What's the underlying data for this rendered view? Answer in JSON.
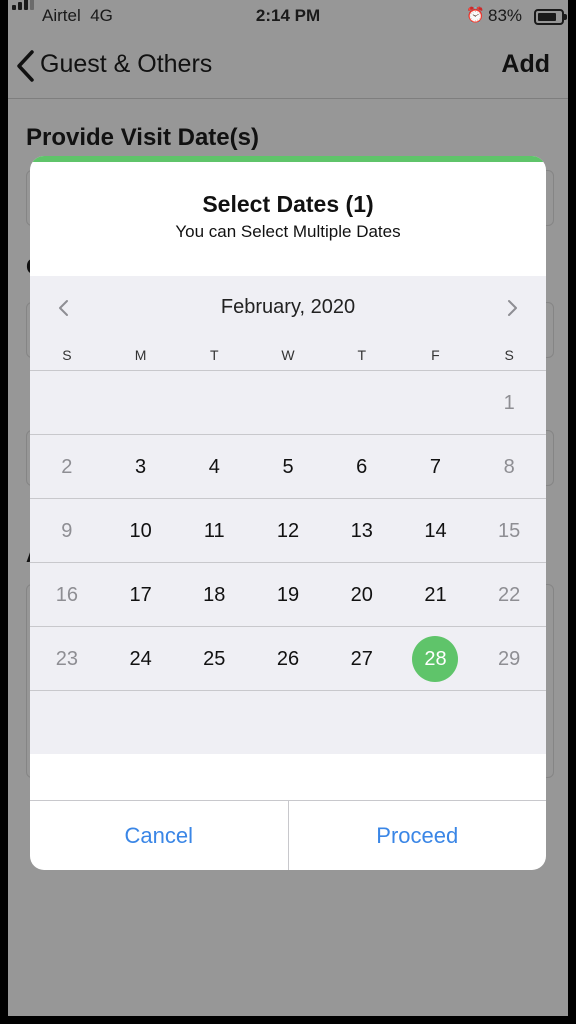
{
  "status_bar": {
    "carrier": "Airtel",
    "network": "4G",
    "time": "2:14 PM",
    "battery_percent": "83%",
    "battery_level": 0.83,
    "icons": [
      "signal-bars-icon",
      "alarm-clock-icon",
      "battery-icon"
    ]
  },
  "nav": {
    "back_icon": "chevron-left-icon",
    "title": "Guest & Others",
    "action_label": "Add"
  },
  "form": {
    "visit_dates_heading": "Provide Visit Date(s)",
    "partial_letters": [
      "C",
      "A"
    ]
  },
  "modal": {
    "title": "Select Dates (1)",
    "subtitle": "You can Select Multiple Dates",
    "accent_color": "#5fc46a",
    "cancel_label": "Cancel",
    "proceed_label": "Proceed",
    "button_color": "#3a86e6"
  },
  "calendar": {
    "month_label": "February, 2020",
    "prev_icon": "chevron-left-icon",
    "next_icon": "chevron-right-icon",
    "weekdays": [
      "S",
      "M",
      "T",
      "W",
      "T",
      "F",
      "S"
    ],
    "weeks": [
      [
        "",
        "",
        "",
        "",
        "",
        "",
        "1"
      ],
      [
        "2",
        "3",
        "4",
        "5",
        "6",
        "7",
        "8"
      ],
      [
        "9",
        "10",
        "11",
        "12",
        "13",
        "14",
        "15"
      ],
      [
        "16",
        "17",
        "18",
        "19",
        "20",
        "21",
        "22"
      ],
      [
        "23",
        "24",
        "25",
        "26",
        "27",
        "28",
        "29"
      ],
      [
        "",
        "",
        "",
        "",
        "",
        "",
        ""
      ]
    ],
    "selected_day": "28",
    "selected_color": "#5fc46a"
  }
}
